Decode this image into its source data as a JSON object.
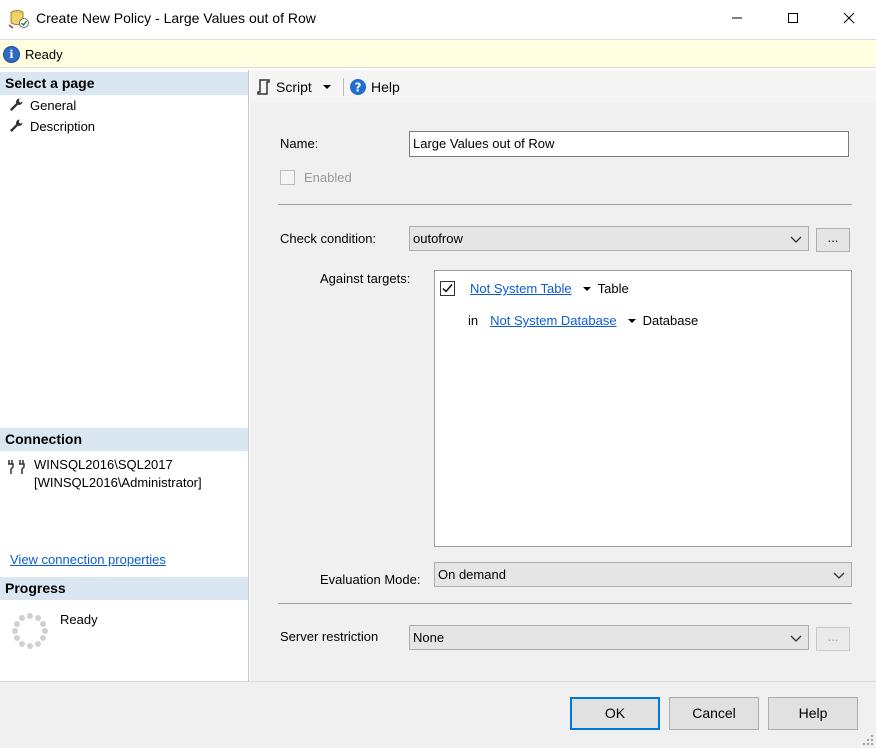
{
  "window": {
    "title": "Create New Policy - Large Values out of Row",
    "icons": {
      "app": "policy-app-icon",
      "minimize": "minimize-icon",
      "maximize": "maximize-icon",
      "close": "close-icon"
    }
  },
  "status": {
    "text": "Ready",
    "icon": "info-icon"
  },
  "left_pane": {
    "select_page_header": "Select a page",
    "pages": [
      {
        "label": "General",
        "icon": "wrench-icon"
      },
      {
        "label": "Description",
        "icon": "wrench-icon"
      }
    ],
    "connection_header": "Connection",
    "connection_server": "WINSQL2016\\SQL2017",
    "connection_user": "[WINSQL2016\\Administrator]",
    "view_connection_link": "View connection properties",
    "progress_header": "Progress",
    "progress_status": "Ready"
  },
  "toolbar": {
    "script_label": "Script",
    "help_label": "Help"
  },
  "form": {
    "name_label": "Name:",
    "name_value": "Large Values out of Row",
    "enabled_label": "Enabled",
    "enabled_checked": false,
    "check_condition_label": "Check condition:",
    "check_condition_value": "outofrow",
    "ellipsis": "...",
    "against_targets_label": "Against targets:",
    "targets": {
      "row1_checked": true,
      "row1_link": "Not System Table",
      "row1_type": "Table",
      "row2_prefix": "in",
      "row2_link": "Not System Database",
      "row2_type": "Database"
    },
    "evaluation_mode_label": "Evaluation Mode:",
    "evaluation_mode_value": "On demand",
    "server_restriction_label": "Server restriction",
    "server_restriction_value": "None"
  },
  "buttons": {
    "ok": "OK",
    "cancel": "Cancel",
    "help": "Help"
  },
  "colors": {
    "accent": "#0078d7",
    "link": "#0b5cd5",
    "section_header": "#dbe6f3",
    "status_bg": "#fffee0"
  }
}
